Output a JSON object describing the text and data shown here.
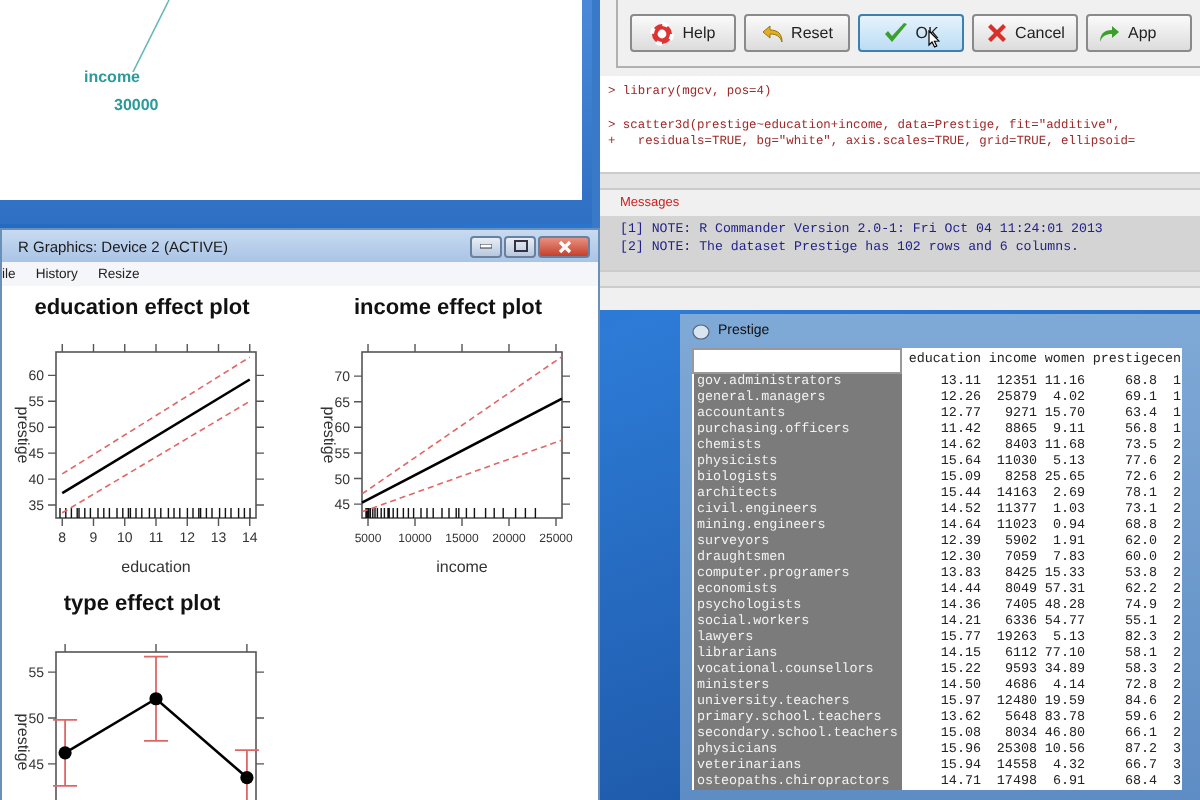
{
  "rgl_window": {
    "axis_label": "income",
    "tick_label": "30000"
  },
  "rcmdr": {
    "buttons": [
      {
        "label": "Help",
        "kind": "help",
        "focused": false
      },
      {
        "label": "Reset",
        "kind": "reset",
        "focused": false
      },
      {
        "label": "OK",
        "kind": "ok",
        "focused": true
      },
      {
        "label": "Cancel",
        "kind": "cancel",
        "focused": false
      },
      {
        "label": "App",
        "kind": "apply",
        "focused": false
      }
    ],
    "script_lines": [
      "> library(mgcv, pos=4)",
      "> scatter3d(prestige~education+income, data=Prestige, fit=\"additive\",",
      "+   residuals=TRUE, bg=\"white\", axis.scales=TRUE, grid=TRUE, ellipsoid="
    ],
    "messages_label": "Messages",
    "messages": [
      "[1] NOTE: R Commander Version 2.0-1: Fri Oct 04 11:24:01 2013",
      "[2] NOTE: The dataset Prestige has 102 rows and 6 columns."
    ]
  },
  "graphics_window": {
    "title": "R Graphics: Device 2 (ACTIVE)",
    "menu": [
      "ile",
      "History",
      "Resize"
    ],
    "plots": [
      {
        "title": "education effect plot",
        "kind": "band",
        "chart_data": {
          "type": "line",
          "xlabel": "education",
          "ylabel": "prestige",
          "x": [
            8,
            14
          ],
          "series": [
            {
              "color": "#000000",
              "line_style": "solid",
              "values": [
                37.3,
                59.2
              ]
            },
            {
              "color": "#e06666",
              "line_style": "dashed",
              "values": [
                33.5,
                55
              ]
            },
            {
              "color": "#e06666",
              "line_style": "dashed",
              "values": [
                41,
                63.5
              ]
            }
          ],
          "xlim": [
            7.8,
            14.2
          ],
          "ylim": [
            32.5,
            64.5
          ],
          "xticks": [
            8,
            9,
            10,
            11,
            12,
            13,
            14
          ],
          "yticks": [
            35,
            40,
            45,
            50,
            55,
            60
          ]
        }
      },
      {
        "title": "income effect plot",
        "kind": "band",
        "chart_data": {
          "type": "line",
          "xlabel": "income",
          "ylabel": "prestige",
          "x": [
            4360,
            25640
          ],
          "series": [
            {
              "color": "#000000",
              "line_style": "solid",
              "values": [
                45.3,
                65.6
              ]
            },
            {
              "color": "#e06666",
              "line_style": "dashed",
              "values": [
                43.5,
                57.5
              ]
            },
            {
              "color": "#e06666",
              "line_style": "dashed",
              "values": [
                47,
                73.8
              ]
            }
          ],
          "xlim": [
            4360,
            25640
          ],
          "ylim": [
            42.3,
            74.7
          ],
          "xticks": [
            5000,
            10000,
            15000,
            20000,
            25000
          ],
          "yticks": [
            45,
            50,
            55,
            60,
            65,
            70
          ]
        }
      },
      {
        "title": "type effect plot",
        "kind": "errorbar",
        "chart_data": {
          "type": "line",
          "ylabel": "prestige",
          "categories": [
            null,
            null,
            null
          ],
          "series": [
            {
              "color": "#000000",
              "line_style": "solid",
              "marker": "circle",
              "values": [
                46.2,
                52.1,
                43.5
              ],
              "errors": [
                3.6,
                4.6,
                3.0
              ]
            }
          ],
          "ylim": [
            40.4,
            57.2
          ],
          "yticks": [
            45,
            50,
            55
          ]
        }
      }
    ]
  },
  "data_window": {
    "title": "Prestige",
    "columns": [
      "education",
      "income",
      "women",
      "prestige",
      "cen"
    ],
    "rows": [
      {
        "name": "gov.administrators",
        "cells": [
          "13.11",
          "12351",
          "11.16",
          "68.8",
          "1"
        ]
      },
      {
        "name": "general.managers",
        "cells": [
          "12.26",
          "25879",
          "4.02",
          "69.1",
          "1"
        ]
      },
      {
        "name": "accountants",
        "cells": [
          "12.77",
          "9271",
          "15.70",
          "63.4",
          "1"
        ]
      },
      {
        "name": "purchasing.officers",
        "cells": [
          "11.42",
          "8865",
          "9.11",
          "56.8",
          "1"
        ]
      },
      {
        "name": "chemists",
        "cells": [
          "14.62",
          "8403",
          "11.68",
          "73.5",
          "2"
        ]
      },
      {
        "name": "physicists",
        "cells": [
          "15.64",
          "11030",
          "5.13",
          "77.6",
          "2"
        ]
      },
      {
        "name": "biologists",
        "cells": [
          "15.09",
          "8258",
          "25.65",
          "72.6",
          "2"
        ]
      },
      {
        "name": "architects",
        "cells": [
          "15.44",
          "14163",
          "2.69",
          "78.1",
          "2"
        ]
      },
      {
        "name": "civil.engineers",
        "cells": [
          "14.52",
          "11377",
          "1.03",
          "73.1",
          "2"
        ]
      },
      {
        "name": "mining.engineers",
        "cells": [
          "14.64",
          "11023",
          "0.94",
          "68.8",
          "2"
        ]
      },
      {
        "name": "surveyors",
        "cells": [
          "12.39",
          "5902",
          "1.91",
          "62.0",
          "2"
        ]
      },
      {
        "name": "draughtsmen",
        "cells": [
          "12.30",
          "7059",
          "7.83",
          "60.0",
          "2"
        ]
      },
      {
        "name": "computer.programers",
        "cells": [
          "13.83",
          "8425",
          "15.33",
          "53.8",
          "2"
        ]
      },
      {
        "name": "economists",
        "cells": [
          "14.44",
          "8049",
          "57.31",
          "62.2",
          "2"
        ]
      },
      {
        "name": "psychologists",
        "cells": [
          "14.36",
          "7405",
          "48.28",
          "74.9",
          "2"
        ]
      },
      {
        "name": "social.workers",
        "cells": [
          "14.21",
          "6336",
          "54.77",
          "55.1",
          "2"
        ]
      },
      {
        "name": "lawyers",
        "cells": [
          "15.77",
          "19263",
          "5.13",
          "82.3",
          "2"
        ]
      },
      {
        "name": "librarians",
        "cells": [
          "14.15",
          "6112",
          "77.10",
          "58.1",
          "2"
        ]
      },
      {
        "name": "vocational.counsellors",
        "cells": [
          "15.22",
          "9593",
          "34.89",
          "58.3",
          "2"
        ]
      },
      {
        "name": "ministers",
        "cells": [
          "14.50",
          "4686",
          "4.14",
          "72.8",
          "2"
        ]
      },
      {
        "name": "university.teachers",
        "cells": [
          "15.97",
          "12480",
          "19.59",
          "84.6",
          "2"
        ]
      },
      {
        "name": "primary.school.teachers",
        "cells": [
          "13.62",
          "5648",
          "83.78",
          "59.6",
          "2"
        ]
      },
      {
        "name": "secondary.school.teachers",
        "cells": [
          "15.08",
          "8034",
          "46.80",
          "66.1",
          "2"
        ]
      },
      {
        "name": "physicians",
        "cells": [
          "15.96",
          "25308",
          "10.56",
          "87.2",
          "3"
        ]
      },
      {
        "name": "veterinarians",
        "cells": [
          "15.94",
          "14558",
          "4.32",
          "66.7",
          "3"
        ]
      },
      {
        "name": "osteopaths.chiropractors",
        "cells": [
          "14.71",
          "17498",
          "6.91",
          "68.4",
          "3"
        ]
      }
    ]
  }
}
